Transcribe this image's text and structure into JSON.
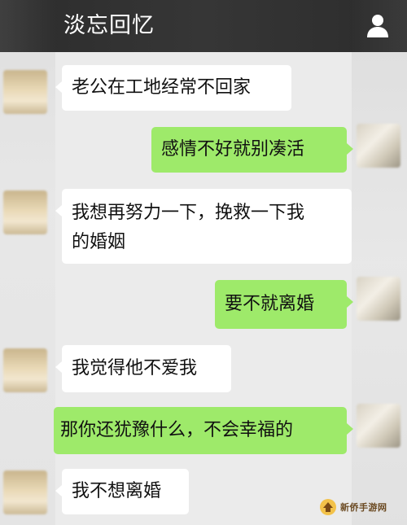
{
  "header": {
    "title": "淡忘回忆"
  },
  "messages": [
    {
      "side": "in",
      "lines": [
        "老公在工地经常不回家"
      ]
    },
    {
      "side": "out",
      "lines": [
        "感情不好就别凑活"
      ]
    },
    {
      "side": "in",
      "lines": [
        "我想再努力一下，挽救一下我",
        "的婚姻"
      ]
    },
    {
      "side": "out",
      "lines": [
        "要不就离婚"
      ]
    },
    {
      "side": "in",
      "lines": [
        "我觉得他不爱我"
      ]
    },
    {
      "side": "out",
      "lines": [
        "那你还犹豫什么，不会幸福的"
      ]
    },
    {
      "side": "in",
      "lines": [
        "我不想离婚"
      ]
    }
  ],
  "watermark": {
    "text": "新侨手游网"
  },
  "colors": {
    "topbar": "#333333",
    "incoming_bubble": "#ffffff",
    "outgoing_bubble": "#9eea6a",
    "background": "#ebebeb"
  },
  "icons": {
    "profile": "person-icon"
  }
}
